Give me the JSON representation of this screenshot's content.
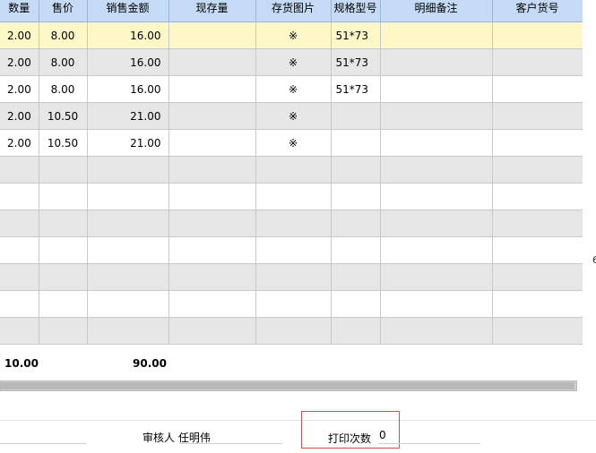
{
  "columns": [
    "数量",
    "售价",
    "销售金额",
    "现存量",
    "存货图片",
    "规格型号",
    "明细备注",
    "客户货号"
  ],
  "rows": [
    {
      "qty": "2.00",
      "price": "8.00",
      "amount": "16.00",
      "stock": "",
      "image": "※",
      "spec": "51*73",
      "note": "",
      "custno": ""
    },
    {
      "qty": "2.00",
      "price": "8.00",
      "amount": "16.00",
      "stock": "",
      "image": "※",
      "spec": "51*73",
      "note": "",
      "custno": ""
    },
    {
      "qty": "2.00",
      "price": "8.00",
      "amount": "16.00",
      "stock": "",
      "image": "※",
      "spec": "51*73",
      "note": "",
      "custno": ""
    },
    {
      "qty": "2.00",
      "price": "10.50",
      "amount": "21.00",
      "stock": "",
      "image": "※",
      "spec": "",
      "note": "",
      "custno": ""
    },
    {
      "qty": "2.00",
      "price": "10.50",
      "amount": "21.00",
      "stock": "",
      "image": "※",
      "spec": "",
      "note": "",
      "custno": ""
    }
  ],
  "empty_row_count": 7,
  "edge_mark": "6",
  "summary": {
    "qty_total": "10.00",
    "amount_total": "90.00"
  },
  "footer": {
    "auditor_label": "审核人",
    "auditor_value": "任明伟",
    "print_count_label": "打印次数",
    "print_count_value": "0"
  }
}
